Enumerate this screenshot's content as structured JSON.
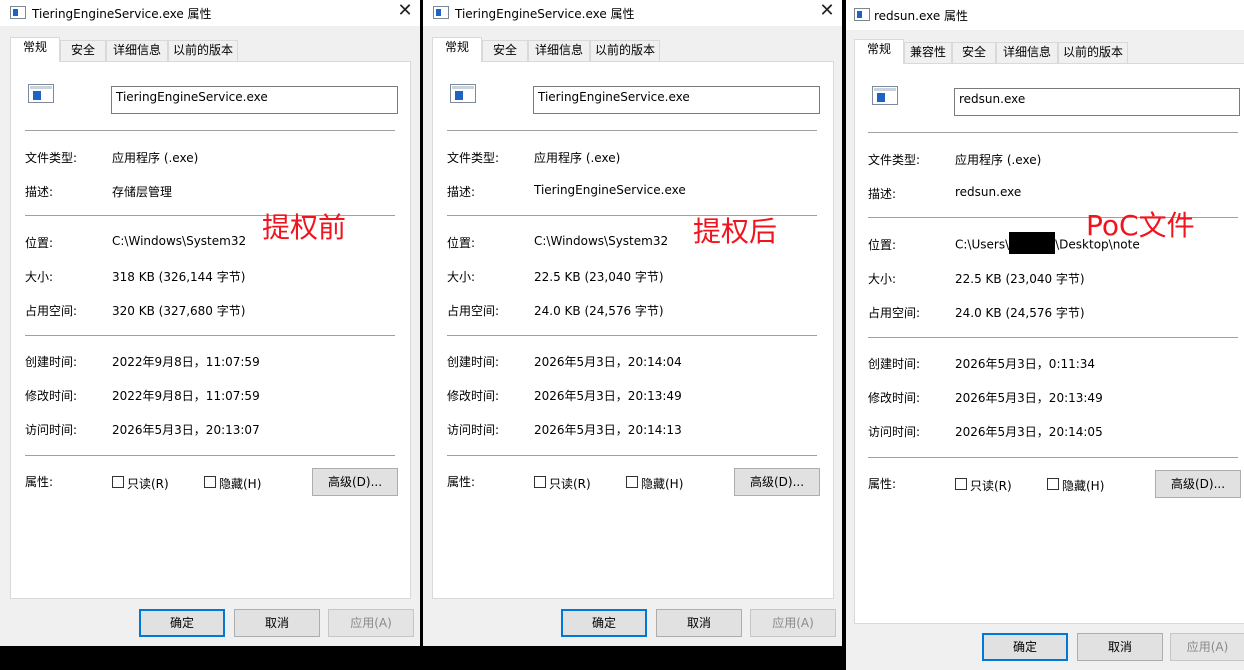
{
  "dialog1": {
    "title": "TieringEngineService.exe 属性",
    "close": "✕",
    "tabs": [
      "常规",
      "安全",
      "详细信息",
      "以前的版本"
    ],
    "file_name": "TieringEngineService.exe",
    "rows": {
      "type_label": "文件类型:",
      "type_value": "应用程序 (.exe)",
      "desc_label": "描述:",
      "desc_value": "存储层管理",
      "loc_label": "位置:",
      "loc_value": "C:\\Windows\\System32",
      "size_label": "大小:",
      "size_value": "318 KB (326,144 字节)",
      "disk_label": "占用空间:",
      "disk_value": "320 KB (327,680 字节)",
      "created_label": "创建时间:",
      "created_value": "2022年9月8日，11:07:59",
      "modified_label": "修改时间:",
      "modified_value": "2022年9月8日，11:07:59",
      "accessed_label": "访问时间:",
      "accessed_value": "2026年5月3日，20:13:07",
      "attr_label": "属性:"
    },
    "readonly": "只读(R)",
    "hidden": "隐藏(H)",
    "advanced": "高级(D)...",
    "ok": "确定",
    "cancel": "取消",
    "apply": "应用(A)",
    "annotation": "提权前"
  },
  "dialog2": {
    "title": "TieringEngineService.exe 属性",
    "close": "✕",
    "tabs": [
      "常规",
      "安全",
      "详细信息",
      "以前的版本"
    ],
    "file_name": "TieringEngineService.exe",
    "rows": {
      "type_label": "文件类型:",
      "type_value": "应用程序 (.exe)",
      "desc_label": "描述:",
      "desc_value": "TieringEngineService.exe",
      "loc_label": "位置:",
      "loc_value": "C:\\Windows\\System32",
      "size_label": "大小:",
      "size_value": "22.5 KB (23,040 字节)",
      "disk_label": "占用空间:",
      "disk_value": "24.0 KB (24,576 字节)",
      "created_label": "创建时间:",
      "created_value": "2026年5月3日，20:14:04",
      "modified_label": "修改时间:",
      "modified_value": "2026年5月3日，20:13:49",
      "accessed_label": "访问时间:",
      "accessed_value": "2026年5月3日，20:14:13",
      "attr_label": "属性:"
    },
    "readonly": "只读(R)",
    "hidden": "隐藏(H)",
    "advanced": "高级(D)...",
    "ok": "确定",
    "cancel": "取消",
    "apply": "应用(A)",
    "annotation": "提权后"
  },
  "dialog3": {
    "title": "redsun.exe 属性",
    "tabs": [
      "常规",
      "兼容性",
      "安全",
      "详细信息",
      "以前的版本"
    ],
    "file_name": "redsun.exe",
    "rows": {
      "type_label": "文件类型:",
      "type_value": "应用程序 (.exe)",
      "desc_label": "描述:",
      "desc_value": "redsun.exe",
      "loc_label": "位置:",
      "loc_prefix": "C:\\Users\\",
      "loc_suffix": "\\Desktop\\note",
      "size_label": "大小:",
      "size_value": "22.5 KB (23,040 字节)",
      "disk_label": "占用空间:",
      "disk_value": "24.0 KB (24,576 字节)",
      "created_label": "创建时间:",
      "created_value": "2026年5月3日，0:11:34",
      "modified_label": "修改时间:",
      "modified_value": "2026年5月3日，20:13:49",
      "accessed_label": "访问时间:",
      "accessed_value": "2026年5月3日，20:14:05",
      "attr_label": "属性:"
    },
    "readonly": "只读(R)",
    "hidden": "隐藏(H)",
    "advanced": "高级(D)...",
    "ok": "确定",
    "cancel": "取消",
    "apply": "应用(A)",
    "annotation": "PoC文件"
  }
}
